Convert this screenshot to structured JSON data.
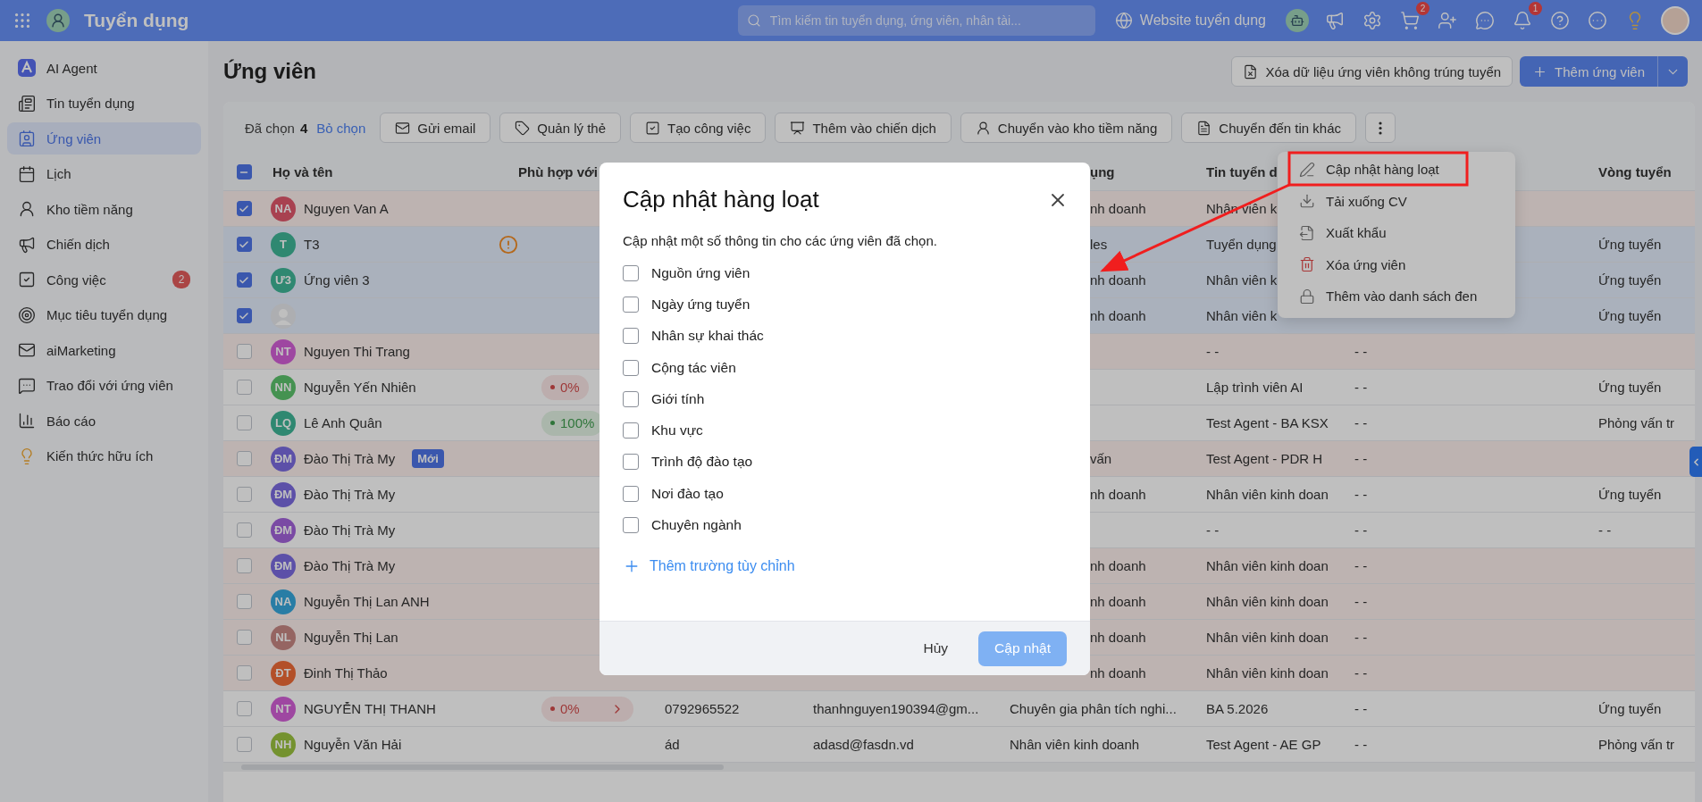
{
  "topbar": {
    "app_title": "Tuyển dụng",
    "search": {
      "placeholder": "Tìm kiếm tin tuyển dụng, ứng viên, nhân tài..."
    },
    "website_link": "Website tuyển dụng",
    "cart_badge": "2",
    "notification_badge": "1"
  },
  "sidebar": {
    "items": [
      {
        "label": "AI Agent",
        "selected": false
      },
      {
        "label": "Tin tuyển dụng",
        "selected": false
      },
      {
        "label": "Ứng viên",
        "selected": true
      },
      {
        "label": "Lịch",
        "selected": false
      },
      {
        "label": "Kho tiềm năng",
        "selected": false
      },
      {
        "label": "Chiến dịch",
        "selected": false
      },
      {
        "label": "Công việc",
        "selected": false,
        "badge": "2"
      },
      {
        "label": "Mục tiêu tuyển dụng",
        "selected": false
      },
      {
        "label": "aiMarketing",
        "selected": false
      },
      {
        "label": "Trao đổi với ứng viên",
        "selected": false
      },
      {
        "label": "Báo cáo",
        "selected": false
      },
      {
        "label": "Kiến thức hữu ích",
        "selected": false
      }
    ]
  },
  "page": {
    "title": "Ứng viên",
    "clear_button": "Xóa dữ liệu ứng viên không trúng tuyển",
    "add_button": "Thêm ứng viên"
  },
  "bulk_bar": {
    "selected_label": "Đã chọn",
    "selected_count": "4",
    "deselect_link": "Bỏ chọn",
    "actions": [
      "Gửi email",
      "Quản lý thẻ",
      "Tạo công việc",
      "Thêm vào chiến dịch",
      "Chuyển vào kho tiềm năng",
      "Chuyển đến tin khác"
    ]
  },
  "more_menu": {
    "items": [
      {
        "label": "Cập nhật hàng loạt",
        "annotated": true,
        "danger": false
      },
      {
        "label": "Tải xuống CV",
        "annotated": false,
        "danger": false
      },
      {
        "label": "Xuất khẩu",
        "annotated": false,
        "danger": false
      },
      {
        "label": "Xóa ứng viên",
        "annotated": false,
        "danger": true
      },
      {
        "label": "Thêm vào danh sách đen",
        "annotated": false,
        "danger": false
      }
    ]
  },
  "table": {
    "partially_selected": true,
    "columns": {
      "name": "Họ và tên",
      "match": "Phù hợp với",
      "position": "ụng",
      "job": "Tin tuyển d",
      "round": "Vòng tuyển"
    },
    "rows": [
      {
        "name": "Nguyen Van A",
        "initials": "NA",
        "color": "#a84150",
        "checked": true,
        "flagged": true,
        "under_dialog": true,
        "position": "nh doanh",
        "job": "Nhân viên k"
      },
      {
        "name": "T3",
        "initials": "T",
        "color": "#2f8871",
        "checked": true,
        "flagged": false,
        "under_dialog": true,
        "warning": true,
        "position": "les",
        "job": "Tuyển dụng",
        "round": "Ứng tuyển"
      },
      {
        "name": "Ứng viên 3",
        "initials": "Ư3",
        "color": "#2f8871",
        "checked": true,
        "flagged": false,
        "under_dialog": true,
        "position": "nh doanh",
        "job": "Nhân viên k",
        "round": "Ứng tuyển"
      },
      {
        "checked": true,
        "flagged": false,
        "under_dialog": true,
        "position": "nh doanh",
        "job": "Nhân viên k",
        "round": "Ứng tuyển"
      },
      {
        "name": "Nguyen Thi Trang",
        "initials": "NT",
        "color": "#9e47a1",
        "checked": false,
        "flagged": true,
        "job": "- -",
        "col7": "- -"
      },
      {
        "name": "Nguyễn Yến Nhiên",
        "initials": "NN",
        "color": "#459251",
        "checked": false,
        "flagged": false,
        "under_dialog": true,
        "match": {
          "text": "0%",
          "kind": "low"
        },
        "job": "Lập trình viên AI",
        "col7": "- -",
        "round": "Ứng tuyển"
      },
      {
        "name": "Lê Anh Quân",
        "initials": "LQ",
        "color": "#2f8871",
        "checked": false,
        "flagged": false,
        "under_dialog": true,
        "match": {
          "text": "100%",
          "kind": "high"
        },
        "job": "Test Agent - BA KSX",
        "col7": "- -",
        "round": "Phỏng vấn tr"
      },
      {
        "name": "Đào Thị Trà My",
        "initials": "ĐM",
        "color": "#5c50a8",
        "checked": false,
        "flagged": true,
        "under_dialog": true,
        "tag": "Mới",
        "position": "vấn",
        "job": "Test Agent - PDR H",
        "col7": "- -"
      },
      {
        "name": "Đào Thị Trà My",
        "initials": "ĐM",
        "color": "#5c50a8",
        "checked": false,
        "flagged": false,
        "under_dialog": true,
        "position": "nh doanh",
        "job": "Nhân viên kinh doan",
        "col7": "- -",
        "round": "Ứng tuyển"
      },
      {
        "name": "Đào Thị Trà My",
        "initials": "ĐM",
        "color": "#7a4aa4",
        "checked": false,
        "flagged": false,
        "job": "- -",
        "col7": "- -",
        "round": "- -"
      },
      {
        "name": "Đào Thị Trà My",
        "initials": "ĐM",
        "color": "#5c50a8",
        "checked": false,
        "flagged": true,
        "under_dialog": true,
        "position": "nh doanh",
        "job": "Nhân viên kinh doan",
        "col7": "- -"
      },
      {
        "name": "Nguyễn Thị Lan ANH",
        "initials": "NA",
        "color": "#287da5",
        "checked": false,
        "flagged": true,
        "under_dialog": true,
        "position": "nh doanh",
        "job": "Nhân viên kinh doan",
        "col7": "- -"
      },
      {
        "name": "Nguyễn Thị Lan",
        "initials": "NL",
        "color": "#956562",
        "checked": false,
        "flagged": true,
        "under_dialog": true,
        "position": "nh doanh",
        "job": "Nhân viên kinh doan",
        "col7": "- -"
      },
      {
        "name": "Đinh Thị Thảo",
        "initials": "ĐT",
        "color": "#b35029",
        "checked": false,
        "flagged": true,
        "under_dialog": true,
        "position": "nh doanh",
        "job": "Nhân viên kinh doan",
        "col7": "- -"
      },
      {
        "name": "NGUYỄN THỊ THANH",
        "initials": "NT",
        "color": "#9e47a1",
        "checked": false,
        "flagged": false,
        "under_dialog": false,
        "match": {
          "text": "0%",
          "kind": "low"
        },
        "phone": "0792965522",
        "email": "thanhnguyen190394@gm...",
        "position": "Chuyên gia phân tích nghi...",
        "job": "BA 5.2026",
        "col7": "- -",
        "round": "Ứng tuyển"
      },
      {
        "name": "Nguyễn Văn Hải",
        "initials": "NH",
        "color": "#74922f",
        "checked": false,
        "flagged": false,
        "under_dialog": false,
        "phone": "ád",
        "email": "adasd@fasdn.vd",
        "position": "Nhân viên kinh doanh",
        "job": "Test Agent - AE GP",
        "col7": "- -",
        "round": "Phỏng vấn tr"
      }
    ]
  },
  "dialog": {
    "title": "Cập nhật hàng loạt",
    "description": "Cập nhật một số thông tin cho các ứng viên đã chọn.",
    "fields": [
      {
        "label": "Nguồn ứng viên",
        "checked": false
      },
      {
        "label": "Ngày ứng tuyển",
        "checked": false
      },
      {
        "label": "Nhân sự khai thác",
        "checked": false
      },
      {
        "label": "Cộng tác viên",
        "checked": false
      },
      {
        "label": "Giới tính",
        "checked": false
      },
      {
        "label": "Khu vực",
        "checked": false
      },
      {
        "label": "Trình độ đào tạo",
        "checked": false
      },
      {
        "label": "Nơi đào tạo",
        "checked": false
      },
      {
        "label": "Chuyên ngành",
        "checked": false
      }
    ],
    "add_field_link": "Thêm trường tùy chỉnh",
    "cancel_button": "Hủy",
    "submit_button": {
      "label": "Cập nhật",
      "disabled": true
    }
  }
}
